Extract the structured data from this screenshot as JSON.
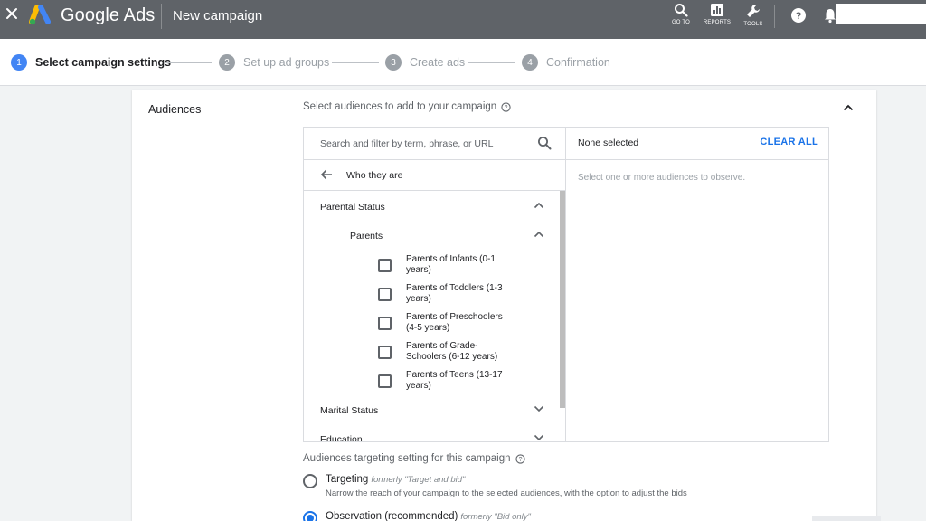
{
  "topbar": {
    "brand": "Google Ads",
    "title": "New campaign",
    "actions": [
      {
        "label": "GO TO",
        "icon": "search-icon"
      },
      {
        "label": "REPORTS",
        "icon": "reports-icon"
      },
      {
        "label": "TOOLS",
        "icon": "wrench-icon"
      }
    ]
  },
  "stepper": {
    "steps": [
      {
        "num": "1",
        "label": "Select campaign settings"
      },
      {
        "num": "2",
        "label": "Set up ad groups"
      },
      {
        "num": "3",
        "label": "Create ads"
      },
      {
        "num": "4",
        "label": "Confirmation"
      }
    ]
  },
  "audiences": {
    "section_title": "Audiences",
    "select_heading": "Select audiences to add to your campaign",
    "search_placeholder": "Search and filter by term, phrase, or URL",
    "back_label": "Who they are",
    "groups": [
      {
        "label": "Parental Status",
        "expanded": true,
        "subgroups": [
          {
            "label": "Parents",
            "options": [
              {
                "line1": "Parents of Infants (0-1",
                "line2": "years)"
              },
              {
                "line1": "Parents of Toddlers (1-3",
                "line2": "years)"
              },
              {
                "line1": "Parents of Preschoolers",
                "line2": "(4-5 years)"
              },
              {
                "line1": "Parents of Grade-",
                "line2": "Schoolers (6-12 years)"
              },
              {
                "line1": "Parents of Teens (13-17",
                "line2": "years)"
              }
            ]
          }
        ]
      },
      {
        "label": "Marital Status",
        "expanded": false
      },
      {
        "label": "Education",
        "expanded": false
      }
    ],
    "right_panel": {
      "none_selected": "None selected",
      "clear_all": "CLEAR ALL",
      "hint": "Select one or more audiences to observe."
    },
    "targeting": {
      "heading": "Audiences targeting setting for this campaign",
      "options": [
        {
          "title": "Targeting",
          "formerly": "formerly \"Target and bid\"",
          "desc": "Narrow the reach of your campaign to the selected audiences, with the option to adjust the bids",
          "checked": false
        },
        {
          "title": "Observation (recommended)",
          "formerly": "formerly \"Bid only\"",
          "desc": "",
          "checked": true
        }
      ]
    }
  },
  "colors": {
    "topbar": "#5f6368",
    "accent": "#1a73e8",
    "step_active": "#4285f4"
  }
}
